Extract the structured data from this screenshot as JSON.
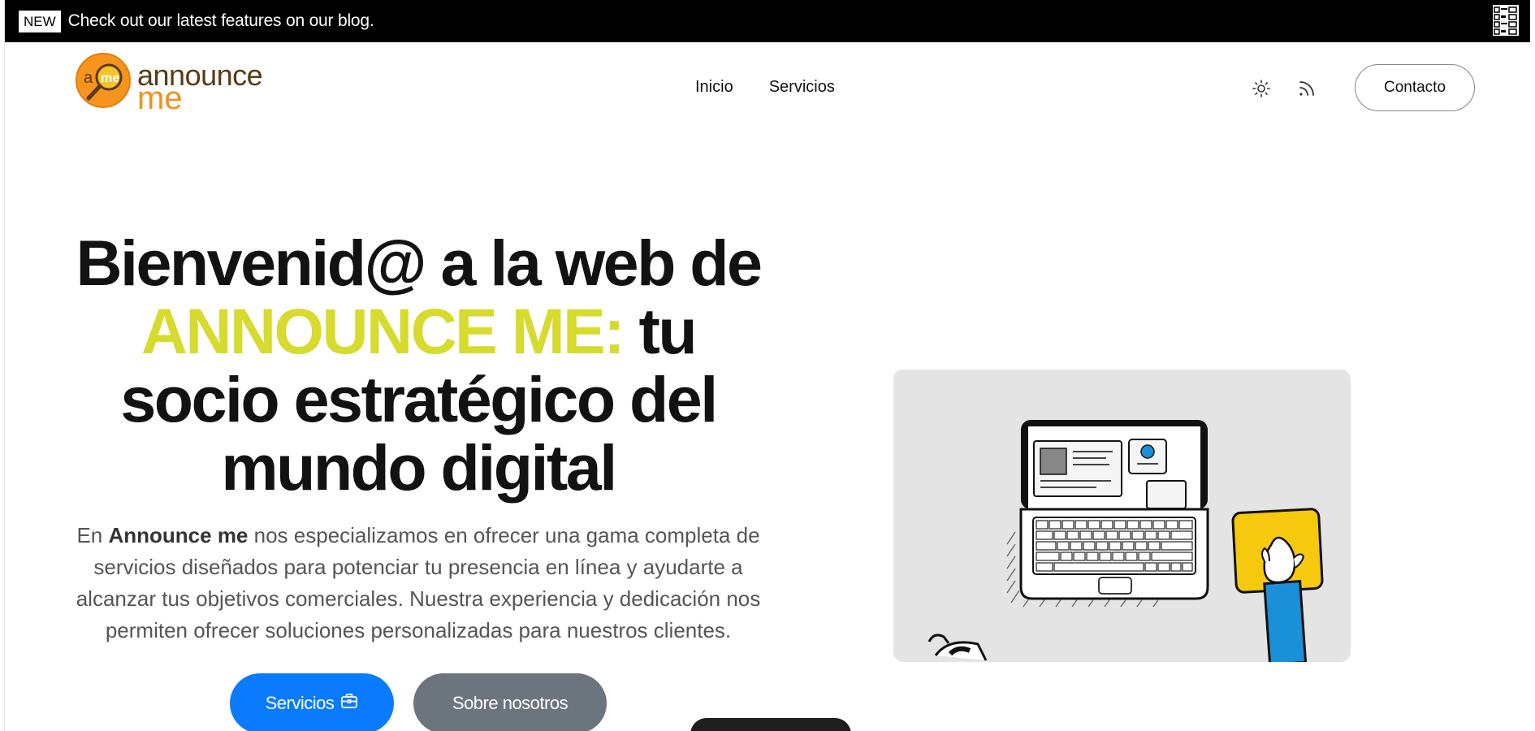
{
  "announcement": {
    "badge": "NEW",
    "text": "Check out our latest features on our blog."
  },
  "brand": {
    "logo_line1": "announce",
    "logo_line2": "me",
    "mark_letters": [
      "a",
      "me"
    ]
  },
  "nav": {
    "items": [
      {
        "label": "Inicio"
      },
      {
        "label": "Servicios"
      }
    ]
  },
  "header_actions": {
    "theme_icon": "sun-icon",
    "feed_icon": "rss-icon",
    "contact_label": "Contacto"
  },
  "hero": {
    "title_part1": "Bienvenid@ a la web de ",
    "title_accent": "ANNOUNCE ME:",
    "title_part2": " tu socio estratégico del mundo digital",
    "desc_prefix": "En ",
    "desc_brand": "Announce me",
    "desc_rest": " nos especializamos en ofrecer una gama completa de servicios diseñados para potenciar tu presencia en línea y ayudarte a alcanzar tus objetivos comerciales. Nuestra experiencia y dedicación nos permiten ofrecer soluciones personalizadas para nuestros clientes.",
    "primary_button": "Servicios",
    "primary_icon": "briefcase-icon",
    "secondary_button": "Sobre nosotros"
  },
  "colors": {
    "accent_yellow": "#d6db2e",
    "primary_blue": "#0a7bff",
    "secondary_gray": "#6c757d",
    "logo_orange": "#f09120",
    "logo_brown": "#5a3a14"
  }
}
